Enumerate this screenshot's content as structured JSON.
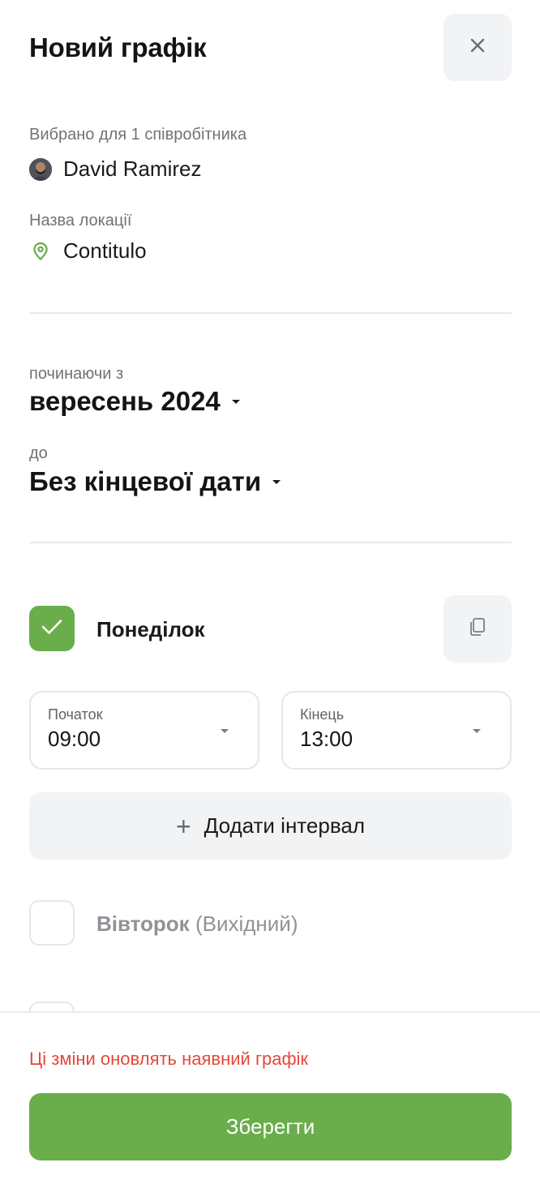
{
  "header": {
    "title": "Новий графік",
    "close_icon": "close-icon"
  },
  "employee": {
    "label": "Вибрано для 1 співробітника",
    "name": "David Ramirez"
  },
  "location": {
    "label": "Назва локації",
    "name": "Contitulo",
    "pin_color": "#6aad4b"
  },
  "period": {
    "start_label": "починаючи з",
    "start_value": "вересень 2024",
    "end_label": "до",
    "end_value": "Без кінцевої дати"
  },
  "days": [
    {
      "name": "Понеділок",
      "checked": true,
      "start_label": "Початок",
      "start_value": "09:00",
      "end_label": "Кінець",
      "end_value": "13:00",
      "add_interval_label": "Додати інтервал"
    },
    {
      "name": "Вівторок",
      "checked": false,
      "off_note": "(Вихідний)"
    }
  ],
  "footer": {
    "warning": "Ці зміни оновлять наявний графік",
    "save_label": "Зберегти"
  },
  "colors": {
    "accent": "#6aad4b",
    "warning": "#e5483b"
  }
}
